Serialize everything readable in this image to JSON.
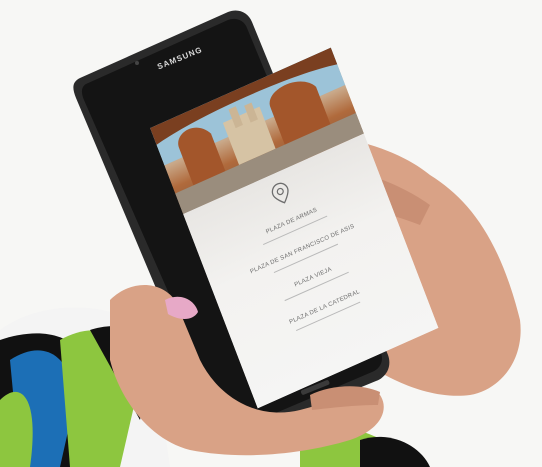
{
  "device": {
    "brand_label": "SAMSUNG"
  },
  "app": {
    "menu_items": [
      "PLAZA DE ARMAS",
      "PLAZA DE SAN FRANCISCO DE ASIS",
      "PLAZA VIEJA",
      "PLAZA DE LA CATEDRAL"
    ]
  },
  "colors": {
    "phone_body": "#2a2a2a",
    "phone_bezel": "#141414",
    "skin": "#dca98c",
    "nail_polish": "#e7a9c7",
    "sleeve_green": "#8dc63f",
    "sleeve_blue": "#1c6fb6",
    "sleeve_black": "#111111"
  },
  "icons": [
    "location-pin-icon",
    "back-icon",
    "home-button-icon"
  ]
}
